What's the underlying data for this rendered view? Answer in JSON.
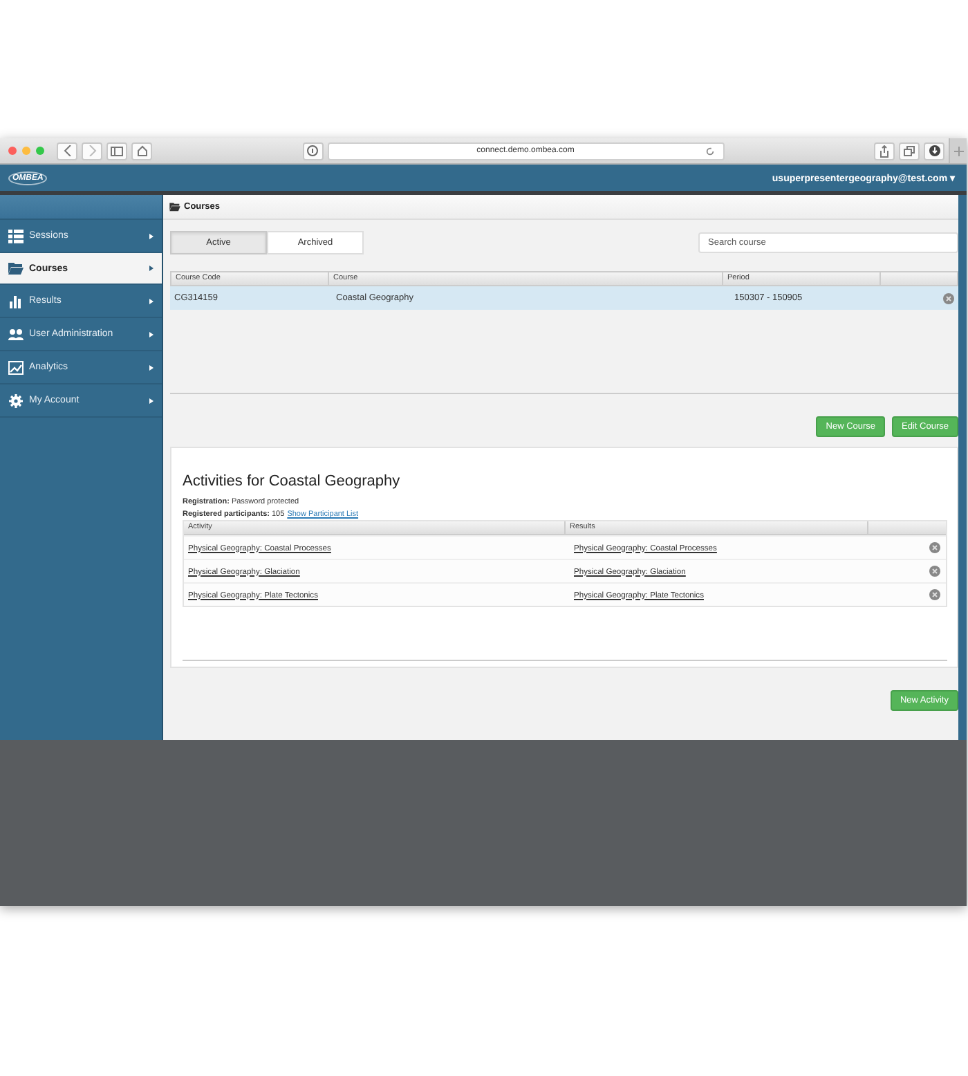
{
  "browser": {
    "url": "connect.demo.ombea.com"
  },
  "header": {
    "logo": "OMBEA",
    "user": "usuperpresentergeography@test.com",
    "caret": "▾"
  },
  "sidebar": {
    "items": [
      {
        "label": "Sessions",
        "selected": false
      },
      {
        "label": "Courses",
        "selected": true
      },
      {
        "label": "Results",
        "selected": false
      },
      {
        "label": "User Administration",
        "selected": false
      },
      {
        "label": "Analytics",
        "selected": false
      },
      {
        "label": "My Account",
        "selected": false
      }
    ]
  },
  "page_title": "Courses",
  "tabs": [
    {
      "label": "Active",
      "selected": true
    },
    {
      "label": "Archived",
      "selected": false
    }
  ],
  "search": {
    "placeholder": "Search course"
  },
  "courses_table": {
    "columns": [
      "Course Code",
      "Course",
      "Period"
    ],
    "rows": [
      {
        "cells": [
          "CG314159",
          "Coastal Geography",
          "150307 - 150905"
        ],
        "selected": true
      }
    ]
  },
  "course_buttons": [
    "New Course",
    "Edit Course"
  ],
  "activities": {
    "title": "Activities for Coastal Geography",
    "registration_label": "Registration:",
    "registration": "Password protected",
    "participants_label": "Registered participants:",
    "participants": "105",
    "participant_link": "Show Participant List",
    "columns": [
      "Activity",
      "Results"
    ],
    "rows": [
      {
        "cells": [
          "Physical Geography: Coastal Processes",
          "Physical Geography: Coastal Processes"
        ]
      },
      {
        "cells": [
          "Physical Geography: Glaciation",
          "Physical Geography: Glaciation"
        ]
      },
      {
        "cells": [
          "Physical Geography: Plate Tectonics",
          "Physical Geography: Plate Tectonics"
        ]
      }
    ]
  },
  "activity_button": "New Activity"
}
